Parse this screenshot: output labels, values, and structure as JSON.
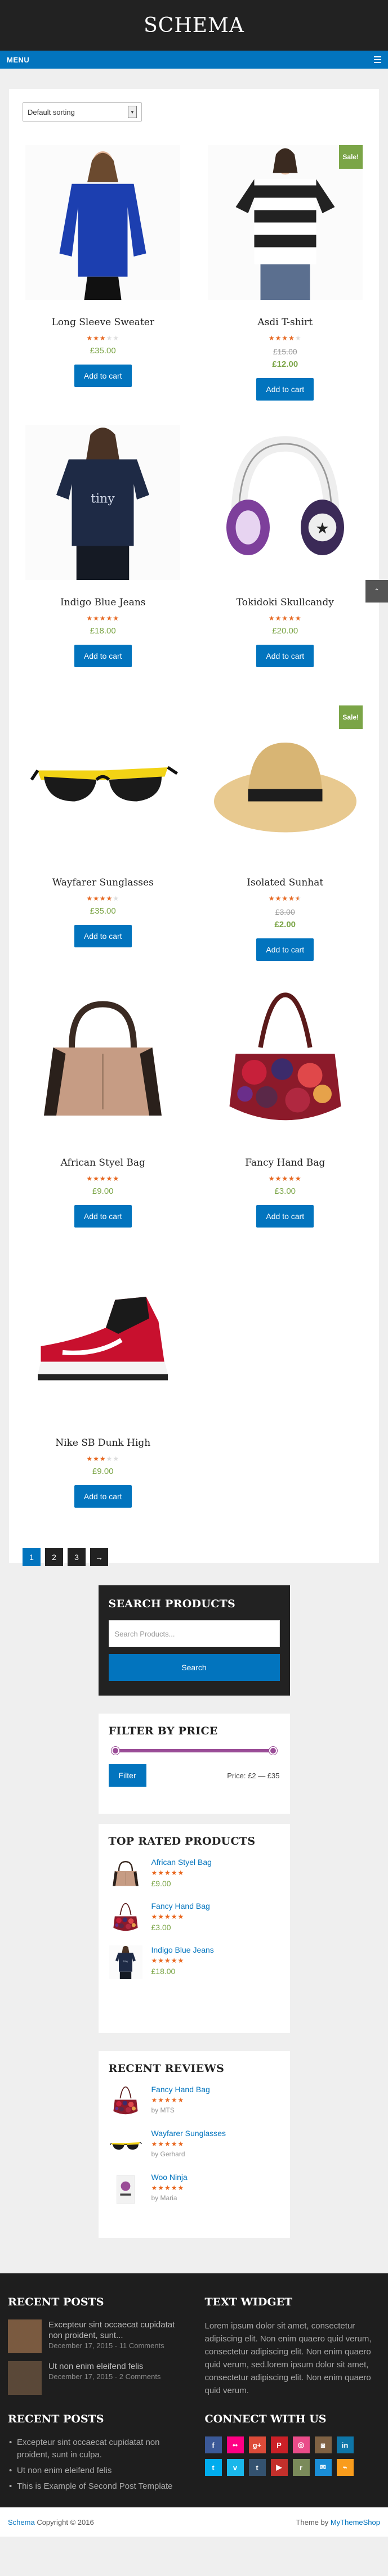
{
  "header": {
    "site_title": "SCHEMA"
  },
  "nav": {
    "menu_label": "MENU"
  },
  "shop": {
    "sort_value": "Default sorting",
    "products": [
      {
        "name": "Long Sleeve Sweater",
        "price": "£35.00",
        "rating": 3,
        "sale": false,
        "old_price": "",
        "button": "Add to cart",
        "image": "blue-shirt"
      },
      {
        "name": "Asdi T-shirt",
        "price": "£12.00",
        "rating": 4,
        "sale": true,
        "old_price": "£15.00",
        "button": "Add to cart",
        "image": "striped-tshirt"
      },
      {
        "name": "Indigo Blue Jeans",
        "price": "£18.00",
        "rating": 5,
        "sale": false,
        "old_price": "",
        "button": "Add to cart",
        "image": "navy-tshirt"
      },
      {
        "name": "Tokidoki Skullcandy",
        "price": "£20.00",
        "rating": 5,
        "sale": false,
        "old_price": "",
        "button": "Add to cart",
        "image": "headphones"
      },
      {
        "name": "Wayfarer Sunglasses",
        "price": "£35.00",
        "rating": 4,
        "sale": false,
        "old_price": "",
        "button": "Add to cart",
        "image": "sunglasses"
      },
      {
        "name": "Isolated Sunhat",
        "price": "£2.00",
        "rating": 4.5,
        "sale": true,
        "old_price": "£3.00",
        "button": "Add to cart",
        "image": "sunhat"
      },
      {
        "name": "African Styel Bag",
        "price": "£9.00",
        "rating": 5,
        "sale": false,
        "old_price": "",
        "button": "Add to cart",
        "image": "tan-bag"
      },
      {
        "name": "Fancy Hand Bag",
        "price": "£3.00",
        "rating": 5,
        "sale": false,
        "old_price": "",
        "button": "Add to cart",
        "image": "patchwork-bag"
      },
      {
        "name": "Nike SB Dunk High",
        "price": "£9.00",
        "rating": 3,
        "sale": false,
        "old_price": "",
        "button": "Add to cart",
        "image": "sneaker"
      }
    ],
    "sale_label": "Sale!",
    "pagination": [
      "1",
      "2",
      "3",
      "→"
    ]
  },
  "search_widget": {
    "title": "SEARCH PRODUCTS",
    "placeholder": "Search Products...",
    "button": "Search"
  },
  "filter_widget": {
    "title": "FILTER BY PRICE",
    "button": "Filter",
    "price_label": "Price: £2 — £35",
    "min": 2,
    "max": 35
  },
  "top_rated": {
    "title": "TOP RATED PRODUCTS",
    "items": [
      {
        "name": "African Styel Bag",
        "price": "£9.00",
        "image": "tan-bag"
      },
      {
        "name": "Fancy Hand Bag",
        "price": "£3.00",
        "image": "patchwork-bag"
      },
      {
        "name": "Indigo Blue Jeans",
        "price": "£18.00",
        "image": "navy-tshirt"
      }
    ]
  },
  "recent_reviews": {
    "title": "RECENT REVIEWS",
    "items": [
      {
        "name": "Fancy Hand Bag",
        "by": "by MTS",
        "image": "patchwork-bag"
      },
      {
        "name": "Wayfarer Sunglasses",
        "by": "by Gerhard",
        "image": "sunglasses"
      },
      {
        "name": "Woo Ninja",
        "by": "by Maria",
        "image": "poster"
      }
    ]
  },
  "footer": {
    "recent_posts_title": "RECENT POSTS",
    "recent_posts": [
      {
        "title": "Excepteur sint occaecat cupidatat non proident, sunt...",
        "meta": "December 17, 2015 - 11 Comments"
      },
      {
        "title": "Ut non enim eleifend felis",
        "meta": "December 17, 2015 - 2 Comments"
      }
    ],
    "text_widget_title": "TEXT WIDGET",
    "text_widget_body": "Lorem ipsum dolor sit amet, consectetur adipiscing elit. Non enim quaero quid verum, consectetur adipiscing elit. Non enim quaero quid verum, sed.lorem ipsum dolor sit amet, consectetur adipiscing elit. Non enim quaero quid verum.",
    "recent_posts2_title": "RECENT POSTS",
    "recent_posts2": [
      "Excepteur sint occaecat cupidatat non proident, sunt in culpa.",
      "Ut non enim eleifend felis",
      "This is Example of Second Post Template"
    ],
    "connect_title": "CONNECT WITH US",
    "social": [
      {
        "icon": "facebook-icon",
        "glyph": "f",
        "color": "#3b5998"
      },
      {
        "icon": "flickr-icon",
        "glyph": "••",
        "color": "#ff0084"
      },
      {
        "icon": "google-plus-icon",
        "glyph": "g+",
        "color": "#dd4b39"
      },
      {
        "icon": "pinterest-icon",
        "glyph": "P",
        "color": "#cb2027"
      },
      {
        "icon": "dribbble-icon",
        "glyph": "◎",
        "color": "#ea4c89"
      },
      {
        "icon": "instagram-icon",
        "glyph": "◙",
        "color": "#7f6244"
      },
      {
        "icon": "linkedin-icon",
        "glyph": "in",
        "color": "#0e76a8"
      },
      {
        "icon": "twitter-icon",
        "glyph": "t",
        "color": "#00aced"
      },
      {
        "icon": "vimeo-icon",
        "glyph": "v",
        "color": "#1ab7ea"
      },
      {
        "icon": "tumblr-icon",
        "glyph": "t",
        "color": "#34526f"
      },
      {
        "icon": "youtube-icon",
        "glyph": "▶",
        "color": "#c4302b"
      },
      {
        "icon": "reddit-icon",
        "glyph": "r",
        "color": "#7a8a5a"
      },
      {
        "icon": "email-icon",
        "glyph": "✉",
        "color": "#1a8dd6"
      },
      {
        "icon": "rss-icon",
        "glyph": "⌁",
        "color": "#f99c1c"
      }
    ]
  },
  "bottom": {
    "brand": "Schema",
    "copyright": " Copyright © 2016",
    "theme_prefix": "Theme by ",
    "theme_link": "MyThemeShop"
  },
  "colors": {
    "accent": "#0274be",
    "price": "#7ba547",
    "star": "#e8671f",
    "sale": "#7ba547",
    "dark": "#222222"
  }
}
